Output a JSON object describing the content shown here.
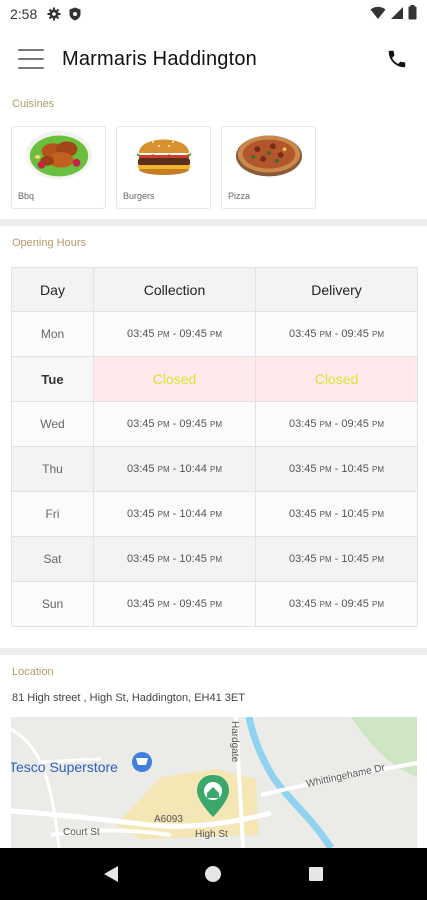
{
  "status_bar": {
    "time": "2:58"
  },
  "app_bar": {
    "title": "Marmaris Haddington"
  },
  "cuisines": {
    "label": "Cuisines",
    "items": [
      {
        "name": "Bbq",
        "icon": "bbq-wings-image"
      },
      {
        "name": "Burgers",
        "icon": "burger-image"
      },
      {
        "name": "Pizza",
        "icon": "pizza-image"
      }
    ]
  },
  "opening_hours": {
    "label": "Opening Hours",
    "headers": [
      "Day",
      "Collection",
      "Delivery"
    ],
    "rows": [
      {
        "day": "Mon",
        "collection": {
          "open": "03:45",
          "close": "09:45"
        },
        "delivery": {
          "open": "03:45",
          "close": "09:45"
        }
      },
      {
        "day": "Tue",
        "collection_status": "Closed",
        "delivery_status": "Closed",
        "today": true
      },
      {
        "day": "Wed",
        "collection": {
          "open": "03:45",
          "close": "09:45"
        },
        "delivery": {
          "open": "03:45",
          "close": "09:45"
        }
      },
      {
        "day": "Thu",
        "collection": {
          "open": "03:45",
          "close": "10:44"
        },
        "delivery": {
          "open": "03:45",
          "close": "10:45"
        }
      },
      {
        "day": "Fri",
        "collection": {
          "open": "03:45",
          "close": "10:44"
        },
        "delivery": {
          "open": "03:45",
          "close": "10:45"
        }
      },
      {
        "day": "Sat",
        "collection": {
          "open": "03:45",
          "close": "10:45"
        },
        "delivery": {
          "open": "03:45",
          "close": "10:45"
        }
      },
      {
        "day": "Sun",
        "collection": {
          "open": "03:45",
          "close": "09:45"
        },
        "delivery": {
          "open": "03:45",
          "close": "09:45"
        }
      }
    ],
    "period_label": "PM"
  },
  "location": {
    "label": "Location",
    "address": "81  High street , High St, Haddington, EH41 3ET",
    "map_labels": {
      "store": "Tesco Superstore",
      "road_a6093": "A6093",
      "court_st": "Court St",
      "high_st": "High St",
      "hardgate": "Hardgate",
      "whittingehame": "Whittingehame Dr"
    }
  },
  "colors": {
    "section_label": "#b59a68",
    "closed_bg": "#fde8ea",
    "closed_text": "#d8e632",
    "map_pin": "#3aa86b",
    "map_water": "#8fd3f1",
    "map_store": "#3f7fe0"
  }
}
